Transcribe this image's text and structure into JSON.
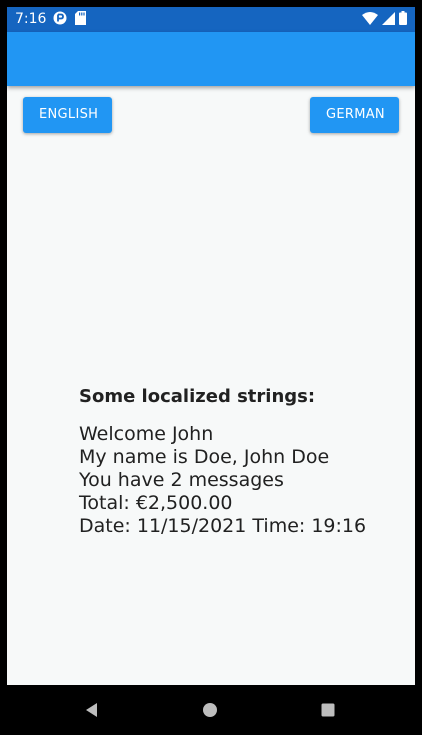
{
  "status_bar": {
    "time": "7:16",
    "left_icons": [
      "media-icon",
      "sd-card-icon"
    ],
    "right_icons": [
      "wifi-icon",
      "signal-icon",
      "battery-icon"
    ]
  },
  "app_bar": {
    "title": "",
    "color": "#2196f3"
  },
  "buttons": {
    "english_label": "ENGLISH",
    "german_label": "GERMAN"
  },
  "content": {
    "heading": "Some localized strings:",
    "welcome": "Welcome John",
    "name": "My name is Doe, John Doe",
    "messages": "You have 2 messages",
    "total": "Total: €2,500.00",
    "datetime": "Date: 11/15/2021 Time: 19:16"
  },
  "nav_bar": {
    "buttons": [
      "back-icon",
      "home-icon",
      "recents-icon"
    ]
  },
  "colors": {
    "status_bar": "#1565c0",
    "accent": "#2196f3",
    "background": "#f7f9f9",
    "text": "#212121"
  }
}
